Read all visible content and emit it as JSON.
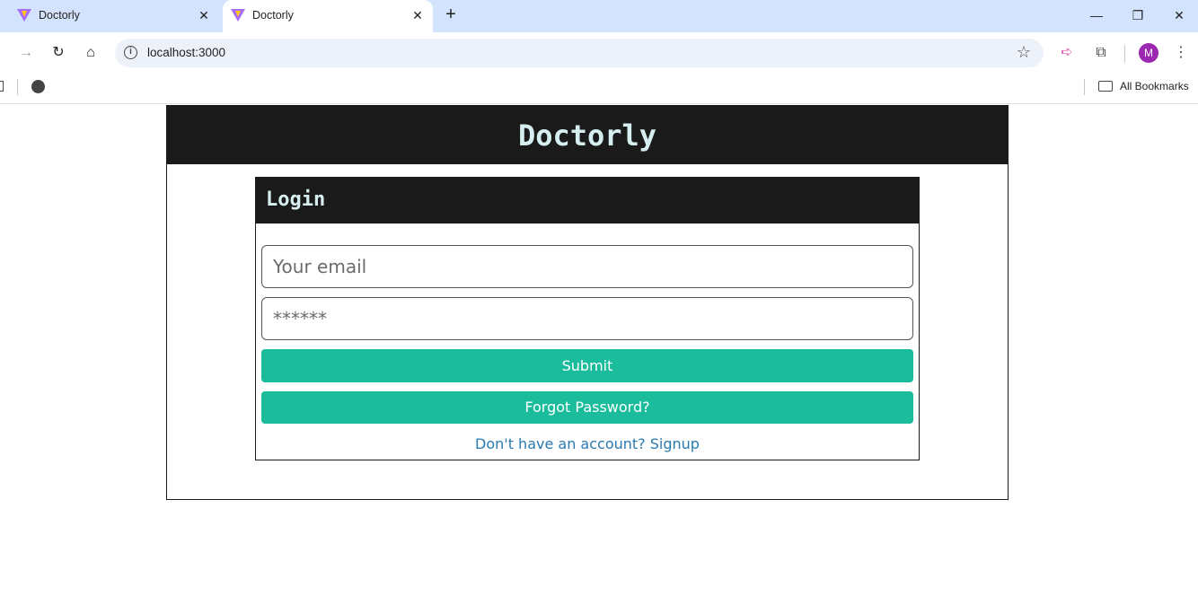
{
  "browser": {
    "tabs": [
      {
        "title": "Doctorly",
        "active": false
      },
      {
        "title": "Doctorly",
        "active": true
      }
    ],
    "new_tab": "+",
    "window_controls": {
      "minimize": "—",
      "restore": "❐",
      "close": "✕"
    },
    "address": {
      "url": "localhost:3000"
    },
    "bookmarks": {
      "all_label": "All Bookmarks"
    },
    "profile_initial": "M",
    "icons": [
      "back-icon",
      "forward-icon",
      "reload-icon",
      "home-icon",
      "site-info-icon",
      "bookmark-star-icon",
      "extension-icon",
      "puzzle-icon",
      "menu-icon",
      "folder-icon",
      "globe-icon"
    ],
    "colors": {
      "tabstrip": "#d3e3fd",
      "omnibox": "#edf2fa",
      "avatar": "#9c27b0"
    }
  },
  "app": {
    "title": "Doctorly",
    "login": {
      "heading": "Login",
      "email_placeholder": "Your email",
      "password_placeholder": "******",
      "submit_label": "Submit",
      "forgot_label": "Forgot Password?",
      "signup_link": "Don't have an account? Signup"
    },
    "colors": {
      "header_bg": "#1a1a1a",
      "title_text": "#d6eef0",
      "button_bg": "#1abc9c",
      "link": "#2a7ab0"
    }
  }
}
